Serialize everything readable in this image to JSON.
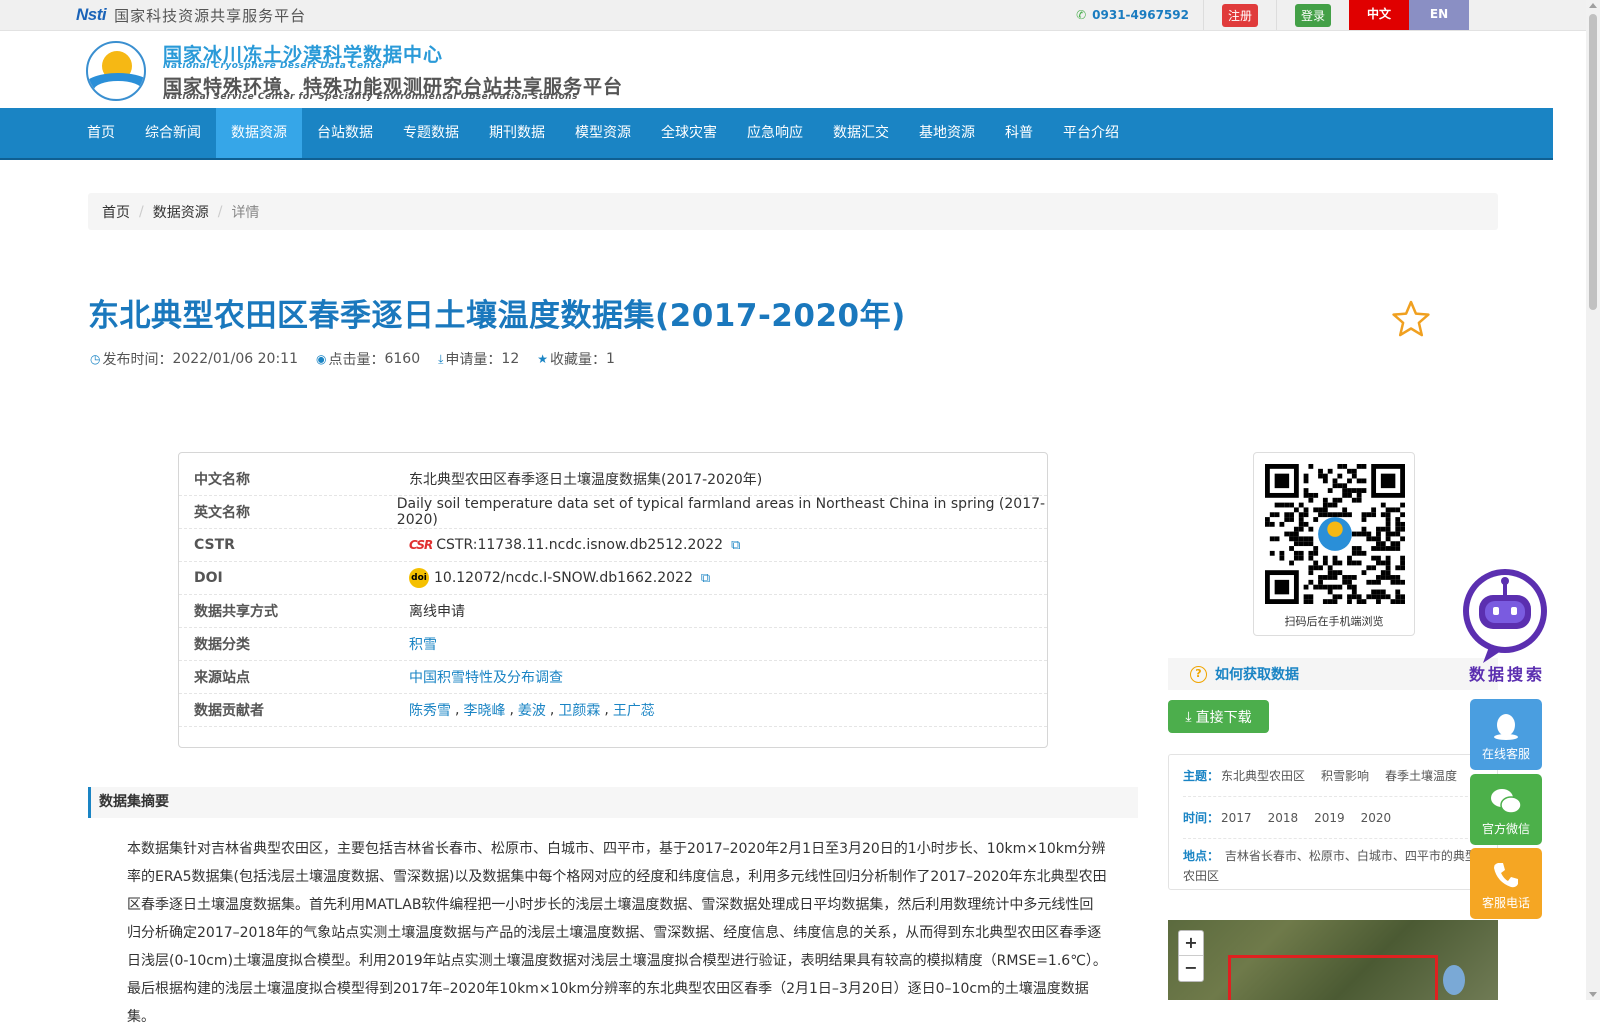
{
  "topbar": {
    "logo_mark": "Nsti",
    "platform_title": "国家科技资源共享服务平台",
    "phone": "0931-4967592",
    "register": "注册",
    "login": "登录",
    "lang_zh": "中文",
    "lang_en": "EN"
  },
  "header": {
    "cn_title": "国家冰川冻土沙漠科学数据中心",
    "en_title": "National Cryosphere Desert Data Center",
    "cn_subtitle": "国家特殊环境、特殊功能观测研究台站共享服务平台",
    "en_subtitle": "National Service Center for Speciality Environmental Observation Stations"
  },
  "nav": {
    "items": [
      "首页",
      "综合新闻",
      "数据资源",
      "台站数据",
      "专题数据",
      "期刊数据",
      "模型资源",
      "全球灾害",
      "应急响应",
      "数据汇交",
      "基地资源",
      "科普",
      "平台介绍"
    ],
    "active": "数据资源"
  },
  "breadcrumb": {
    "home": "首页",
    "section": "数据资源",
    "current": "详情"
  },
  "dataset": {
    "title": "东北典型农田区春季逐日土壤温度数据集(2017-2020年)",
    "publish_label": "发布时间：",
    "publish_time": "2022/01/06 20:11",
    "views_label": "点击量：",
    "views": "6160",
    "requests_label": "申请量：",
    "requests": "12",
    "favorites_label": "收藏量：",
    "favorites": "1"
  },
  "info": {
    "cn_name_label": "中文名称",
    "cn_name": "东北典型农田区春季逐日土壤温度数据集(2017-2020年)",
    "en_name_label": "英文名称",
    "en_name": "Daily soil temperature data set of typical farmland areas in Northeast China in spring (2017-2020)",
    "cstr_label": "CSTR",
    "cstr_logo": "CSR",
    "cstr": "CSTR:11738.11.ncdc.isnow.db2512.2022",
    "doi_label": "DOI",
    "doi_logo": "doi",
    "doi": "10.12072/ncdc.I-SNOW.db1662.2022",
    "share_label": "数据共享方式",
    "share": "离线申请",
    "category_label": "数据分类",
    "category": "积雪",
    "station_label": "来源站点",
    "station": "中国积雪特性及分布调查",
    "contributors_label": "数据贡献者",
    "contributors": [
      "陈秀雪",
      "李晓峰",
      "姜波",
      "卫颜霖",
      "王广蕊"
    ],
    "separator": ","
  },
  "qr": {
    "caption": "扫码后在手机端浏览"
  },
  "abstract": {
    "heading": "数据集摘要",
    "text": "本数据集针对吉林省典型农田区，主要包括吉林省长春市、松原市、白城市、四平市，基于2017–2020年2月1日至3月20日的1小时步长、10km×10km分辨率的ERA5数据集(包括浅层土壤温度数据、雪深数据)以及数据集中每个格网对应的经度和纬度信息，利用多元线性回归分析制作了2017–2020年东北典型农田区春季逐日土壤温度数据集。首先利用MATLAB软件编程把一小时步长的浅层土壤温度数据、雪深数据处理成日平均数据集，然后利用数理统计中多元线性回归分析确定2017–2018年的气象站点实测土壤温度数据与产品的浅层土壤温度数据、雪深数据、经度信息、纬度信息的关系，从而得到东北典型农田区春季逐日浅层(0-10cm)土壤温度拟合模型。利用2019年站点实测土壤温度数据对浅层土壤温度拟合模型进行验证，表明结果具有较高的模拟精度（RMSE=1.6℃）。最后根据构建的浅层土壤温度拟合模型得到2017年–2020年10km×10km分辨率的东北典型农田区春季（2月1日–3月20日）逐日0–10cm的土壤温度数据集。"
  },
  "side": {
    "how_to": "如何获取数据",
    "download": "直接下载",
    "topic_label": "主题：",
    "topics": [
      "东北典型农田区",
      "积雪影响",
      "春季土壤温度"
    ],
    "time_label": "时间：",
    "times": [
      "2017",
      "2018",
      "2019",
      "2020"
    ],
    "place_label": "地点：",
    "place": "吉林省长春市、松原市、白城市、四平市的典型农田区",
    "zoom_in": "+",
    "zoom_out": "−"
  },
  "assistant": {
    "label": "数据搜索"
  },
  "service": {
    "online": "在线客服",
    "wechat": "官方微信",
    "phone": "客服电话"
  },
  "colors": {
    "primary": "#1a84c4",
    "nav_active": "#36a6e8",
    "download": "#4cae4c",
    "register": "#e03b3b",
    "lang_zh": "#e00000"
  }
}
